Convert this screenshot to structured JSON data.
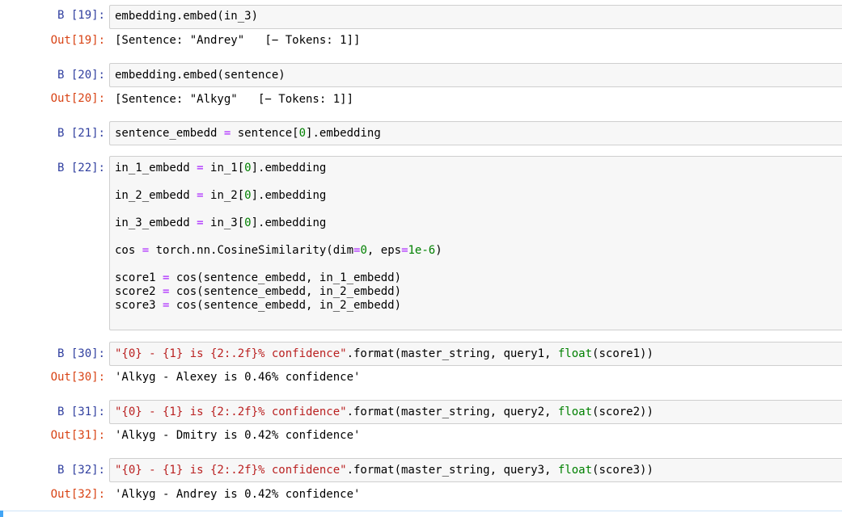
{
  "cells": {
    "c19": {
      "in_prompt": "В [19]:",
      "out_prompt": "Out[19]:",
      "code": "embedding.embed(in_3)",
      "output": "[Sentence: \"Andrey\"   [− Tokens: 1]]"
    },
    "c20": {
      "in_prompt": "В [20]:",
      "out_prompt": "Out[20]:",
      "code": "embedding.embed(sentence)",
      "output": "[Sentence: \"Alkyg\"   [− Tokens: 1]]"
    },
    "c21": {
      "in_prompt": "В [21]:",
      "code_a": "sentence_embedd ",
      "code_op": "=",
      "code_b": " sentence[",
      "code_num": "0",
      "code_c": "].embedding"
    },
    "c22": {
      "in_prompt": "В [22]:",
      "l1_a": "in_1_embedd ",
      "l1_op": "=",
      "l1_b": " in_1[",
      "l1_num": "0",
      "l1_c": "].embedding",
      "l2_a": "in_2_embedd ",
      "l2_op": "=",
      "l2_b": " in_2[",
      "l2_num": "0",
      "l2_c": "].embedding",
      "l3_a": "in_3_embedd ",
      "l3_op": "=",
      "l3_b": " in_3[",
      "l3_num": "0",
      "l3_c": "].embedding",
      "l4_a": "cos ",
      "l4_op": "=",
      "l4_b": " torch.nn.CosineSimilarity(dim",
      "l4_op2": "=",
      "l4_num": "0",
      "l4_c": ", eps",
      "l4_op3": "=",
      "l4_num2": "1e-6",
      "l4_d": ")",
      "l5_a": "score1 ",
      "l5_op": "=",
      "l5_b": " cos(sentence_embedd, in_1_embedd)",
      "l6_a": "score2 ",
      "l6_op": "=",
      "l6_b": " cos(sentence_embedd, in_2_embedd)",
      "l7_a": "score3 ",
      "l7_op": "=",
      "l7_b": " cos(sentence_embedd, in_2_embedd)"
    },
    "c30": {
      "in_prompt": "В [30]:",
      "out_prompt": "Out[30]:",
      "str": "\"{0} - {1} is {2:.2f}% confidence\"",
      "mid": ".format(master_string, query1, ",
      "fn": "float",
      "end": "(score1))",
      "output": "'Alkyg - Alexey is 0.46% confidence'"
    },
    "c31": {
      "in_prompt": "В [31]:",
      "out_prompt": "Out[31]:",
      "str": "\"{0} - {1} is {2:.2f}% confidence\"",
      "mid": ".format(master_string, query2, ",
      "fn": "float",
      "end": "(score2))",
      "output": "'Alkyg - Dmitry is 0.42% confidence'"
    },
    "c32": {
      "in_prompt": "В [32]:",
      "out_prompt": "Out[32]:",
      "str": "\"{0} - {1} is {2:.2f}% confidence\"",
      "mid": ".format(master_string, query3, ",
      "fn": "float",
      "end": "(score3))",
      "output": "'Alkyg - Andrey is 0.42% confidence'"
    }
  },
  "colors": {
    "in_prompt": "#303f9f",
    "out_prompt": "#d84315",
    "operator": "#aa22ff",
    "number": "#008000",
    "string": "#ba2121",
    "active_cell": "#42a5f5"
  }
}
